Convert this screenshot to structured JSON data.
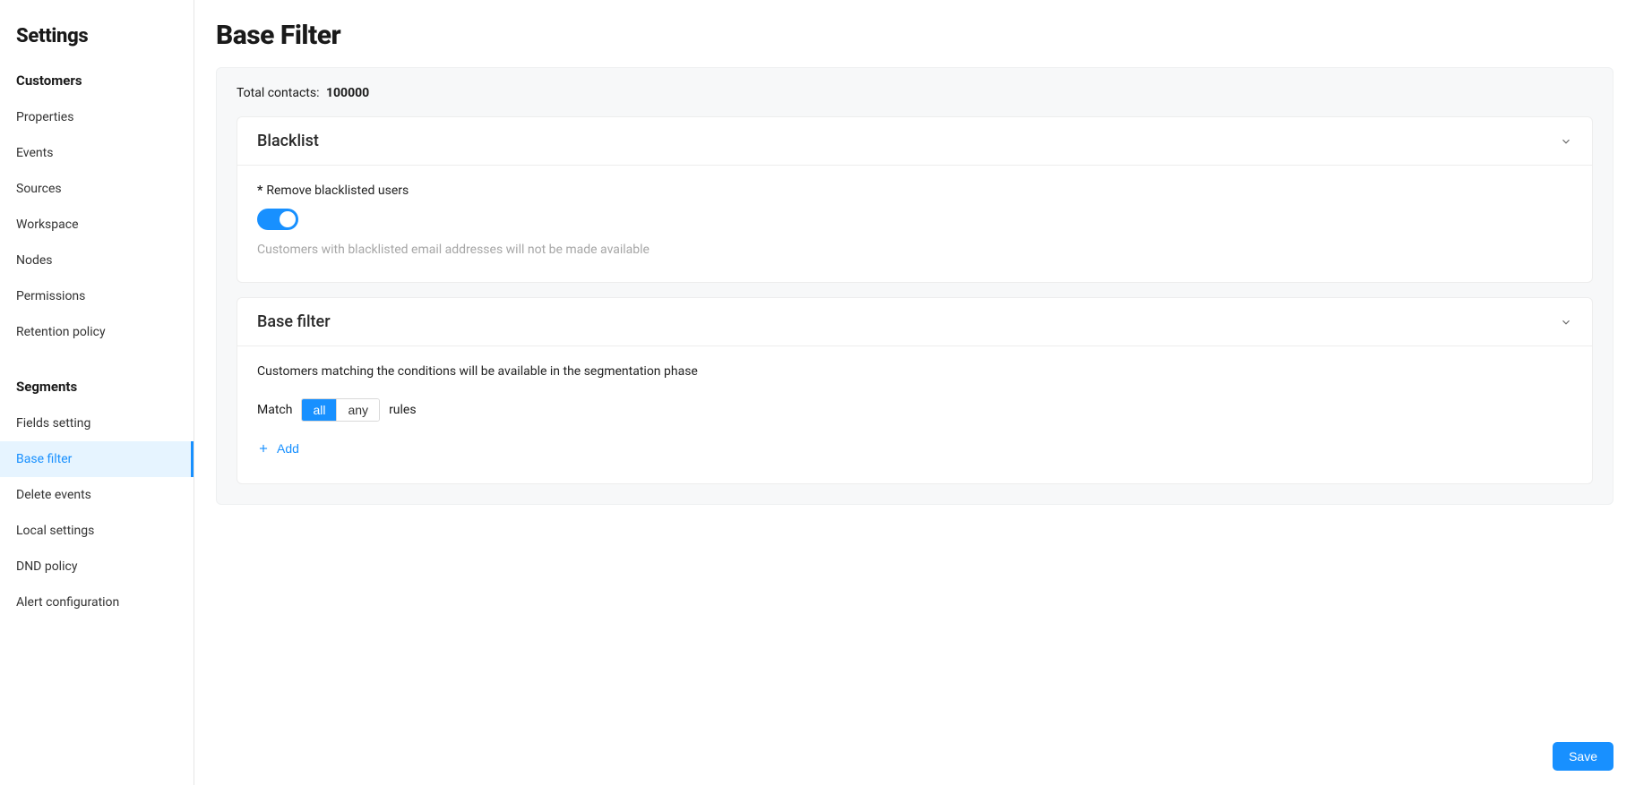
{
  "sidebar": {
    "title": "Settings",
    "sections": [
      {
        "header": "Customers",
        "items": [
          {
            "label": "Properties",
            "active": false
          },
          {
            "label": "Events",
            "active": false
          },
          {
            "label": "Sources",
            "active": false
          },
          {
            "label": "Workspace",
            "active": false
          },
          {
            "label": "Nodes",
            "active": false
          },
          {
            "label": "Permissions",
            "active": false
          },
          {
            "label": "Retention policy",
            "active": false
          }
        ]
      },
      {
        "header": "Segments",
        "items": [
          {
            "label": "Fields setting",
            "active": false
          },
          {
            "label": "Base filter",
            "active": true
          },
          {
            "label": "Delete events",
            "active": false
          },
          {
            "label": "Local settings",
            "active": false
          },
          {
            "label": "DND policy",
            "active": false
          },
          {
            "label": "Alert configuration",
            "active": false
          }
        ]
      }
    ]
  },
  "page": {
    "title": "Base Filter",
    "total_label": "Total contacts:",
    "total_value": "100000"
  },
  "blacklist": {
    "panel_title": "Blacklist",
    "field_asterisk": "*",
    "field_label": "Remove blacklisted users",
    "toggle_on": true,
    "help": "Customers with blacklisted email addresses will not be made available"
  },
  "basefilter": {
    "panel_title": "Base filter",
    "desc": "Customers matching the conditions will be available in the segmentation phase",
    "match_label_pre": "Match",
    "match_all": "all",
    "match_any": "any",
    "match_label_post": "rules",
    "add_label": "Add"
  },
  "footer": {
    "save": "Save"
  }
}
